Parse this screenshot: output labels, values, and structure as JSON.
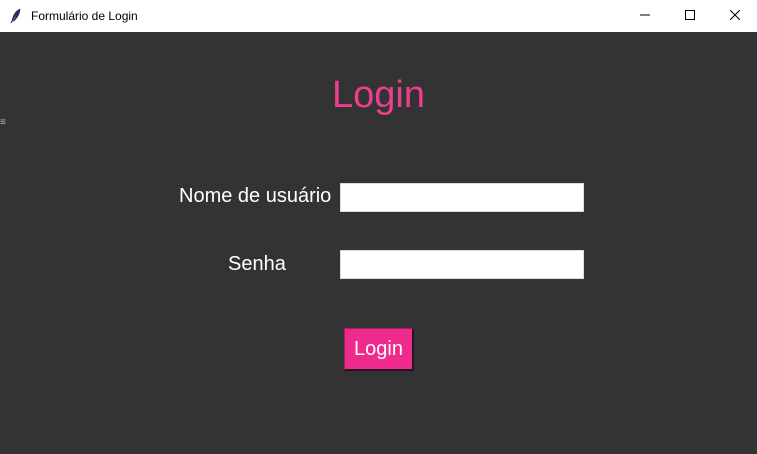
{
  "window": {
    "title": "Formulário de Login",
    "controls": {
      "minimize": "minimize-icon",
      "maximize": "maximize-icon",
      "close": "close-icon"
    }
  },
  "form": {
    "heading": "Login",
    "username_label": "Nome de usuário",
    "username_value": "",
    "password_label": "Senha",
    "password_value": "",
    "submit_label": "Login"
  },
  "colors": {
    "background": "#333333",
    "accent": "#ec3d8f",
    "button": "#ee2b8c",
    "text": "#ffffff"
  }
}
